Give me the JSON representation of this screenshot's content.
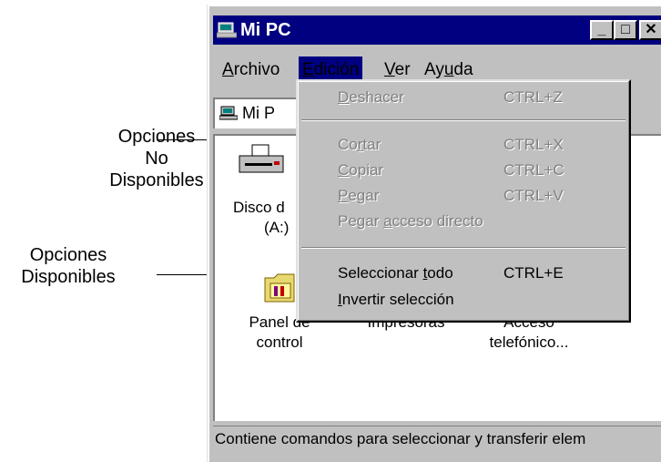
{
  "annotations": {
    "unavailable": [
      "Opciones No",
      "Disponibles"
    ],
    "available": [
      "Opciones",
      "Disponibles"
    ]
  },
  "window": {
    "title": "Mi PC",
    "minimize": "_",
    "maximize": "□",
    "close": "✕"
  },
  "menubar": {
    "archivo": {
      "pre": "",
      "u": "A",
      "post": "rchivo"
    },
    "edicion": {
      "pre": "",
      "u": "E",
      "post": "dición"
    },
    "ver": {
      "pre": "",
      "u": "V",
      "post": "er"
    },
    "ayuda": {
      "pre": "Ay",
      "u": "u",
      "post": "da"
    }
  },
  "address": {
    "value": "Mi P"
  },
  "edit_menu": {
    "deshacer": {
      "pre": "",
      "u": "D",
      "post": "eshacer",
      "shortcut": "CTRL+Z",
      "enabled": false
    },
    "cortar": {
      "pre": "Co",
      "u": "r",
      "post": "tar",
      "shortcut": "CTRL+X",
      "enabled": false
    },
    "copiar": {
      "pre": "",
      "u": "C",
      "post": "opiar",
      "shortcut": "CTRL+C",
      "enabled": false
    },
    "pegar": {
      "pre": "",
      "u": "P",
      "post": "egar",
      "shortcut": "CTRL+V",
      "enabled": false
    },
    "pegar_acceso": {
      "pre": "Pegar ",
      "u": "a",
      "post": "cceso directo",
      "shortcut": "",
      "enabled": false
    },
    "seleccionar": {
      "pre": "Seleccionar ",
      "u": "t",
      "post": "odo",
      "shortcut": "CTRL+E",
      "enabled": true
    },
    "invertir": {
      "pre": "",
      "u": "I",
      "post": "nvertir selección",
      "shortcut": "",
      "enabled": true
    }
  },
  "items": {
    "disco": [
      "Disco d",
      "(A:)"
    ],
    "panel": [
      "Panel de",
      "control"
    ],
    "impresoras": [
      "Impresoras"
    ],
    "acceso": [
      "Acceso",
      "telefónico..."
    ]
  },
  "status": "Contiene comandos para seleccionar y transferir elem",
  "colors": {
    "titlebar": "#000080",
    "face": "#c0c0c0",
    "disabled_text": "#808080"
  }
}
